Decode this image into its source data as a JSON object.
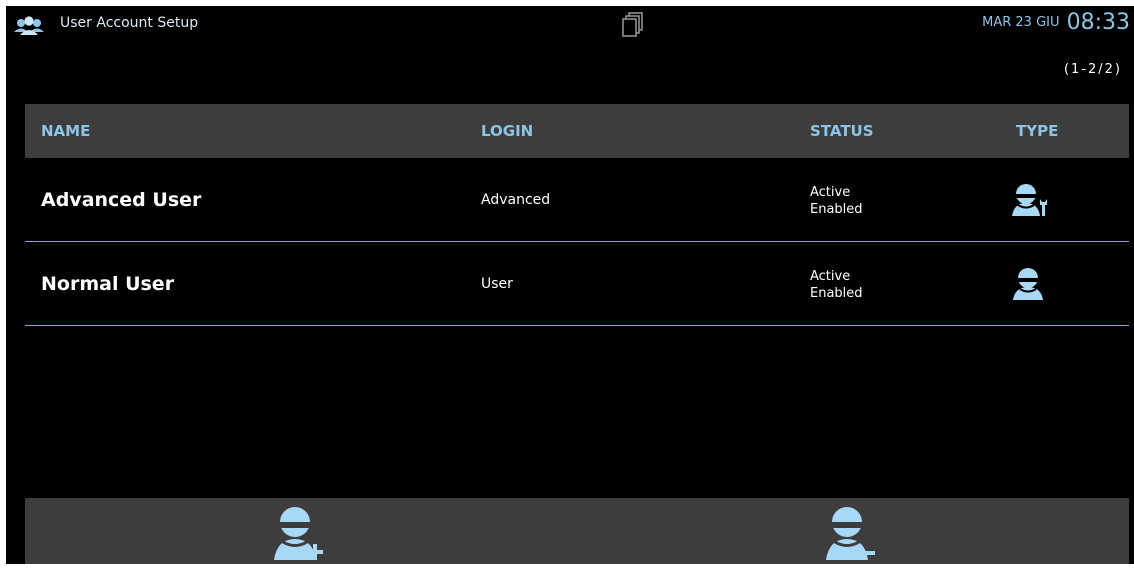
{
  "header": {
    "title": "User Account Setup",
    "date": "MAR 23 GIU",
    "time": "08:33",
    "title_icon": "users-group-icon",
    "copy_icon": "copy-icon"
  },
  "pager": "(1-2/2)",
  "table": {
    "columns": [
      "NAME",
      "LOGIN",
      "STATUS",
      "TYPE"
    ],
    "rows": [
      {
        "name": "Advanced User",
        "login": "Advanced",
        "status_line1": "Active",
        "status_line2": "Enabled",
        "type_icon": "advanced-user-icon"
      },
      {
        "name": "Normal User",
        "login": "User",
        "status_line1": "Active",
        "status_line2": "Enabled",
        "type_icon": "normal-user-icon"
      }
    ]
  },
  "toolbar": {
    "add_icon": "add-user-icon",
    "remove_icon": "remove-user-icon"
  },
  "colors": {
    "accent": "#8cc5e8",
    "background": "#000000",
    "bar": "#3d3d3d",
    "divider": "#6eb3da"
  }
}
